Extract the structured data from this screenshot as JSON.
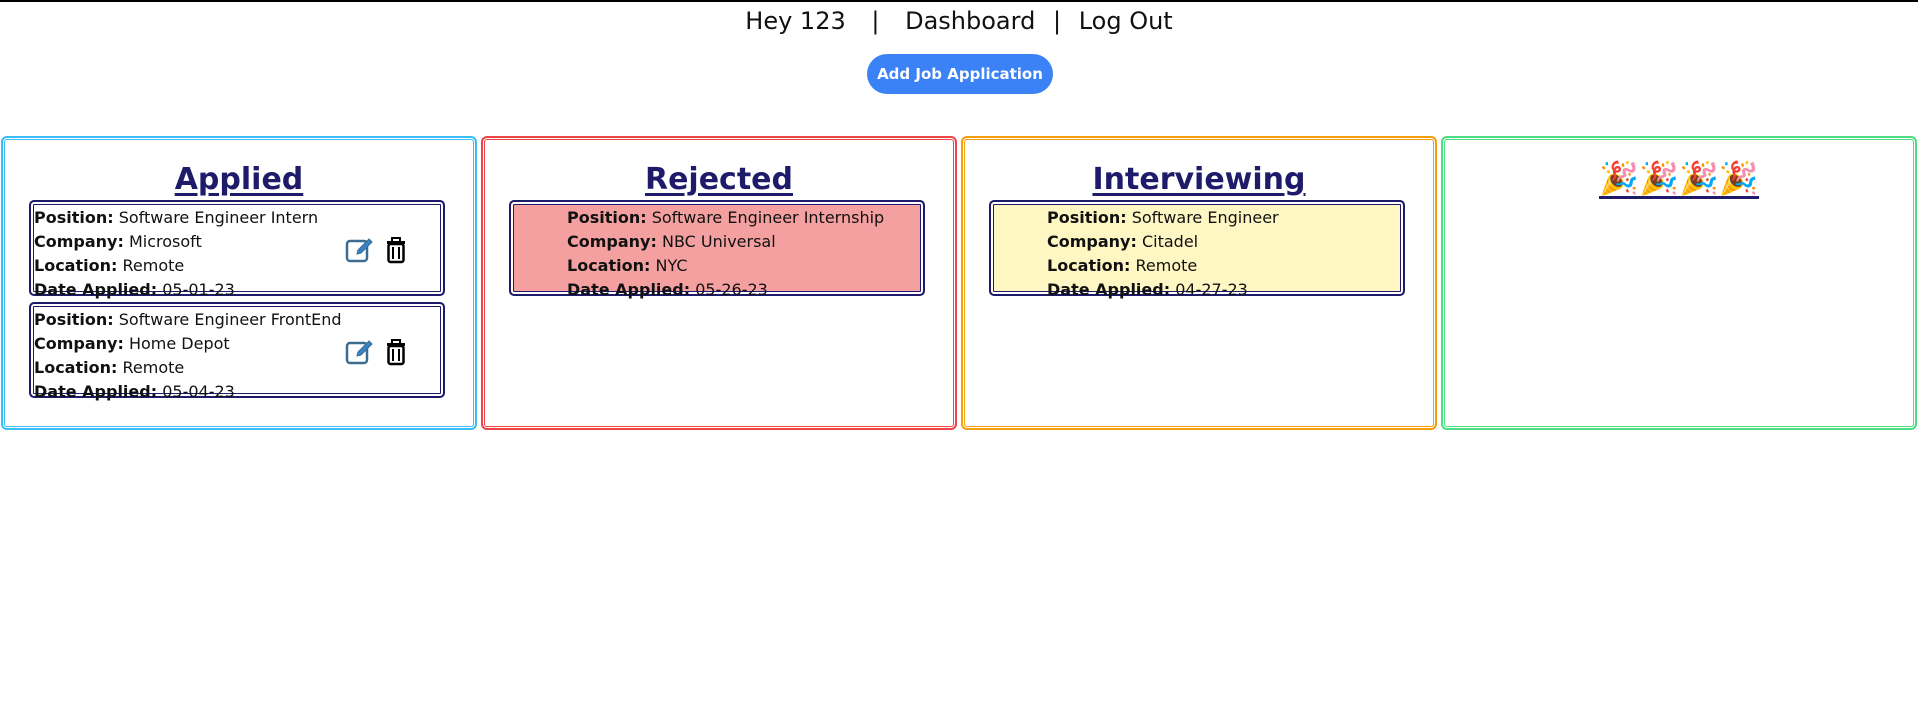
{
  "nav": {
    "greeting": "Hey 123",
    "sep1": "|",
    "dashboard": "Dashboard",
    "sep2": "|",
    "logout": "Log Out"
  },
  "add_button_label": "Add Job Application",
  "columns": {
    "applied": {
      "title": "Applied",
      "border_color": "#38bdf8",
      "cards": [
        {
          "position_label": "Position:",
          "position": "Software Engineer Intern",
          "company_label": "Company:",
          "company": "Microsoft",
          "location_label": "Location:",
          "location": "Remote",
          "date_label": "Date Applied:",
          "date": "05-01-23"
        },
        {
          "position_label": "Position:",
          "position": "Software Engineer FrontEnd",
          "company_label": "Company:",
          "company": "Home Depot",
          "location_label": "Location:",
          "location": "Remote",
          "date_label": "Date Applied:",
          "date": "05-04-23"
        }
      ]
    },
    "rejected": {
      "title": "Rejected",
      "border_color": "#ef4444",
      "card_color": "#f5a0a0",
      "cards": [
        {
          "position_label": "Position:",
          "position": "Software Engineer Internship",
          "company_label": "Company:",
          "company": "NBC Universal",
          "location_label": "Location:",
          "location": "NYC",
          "date_label": "Date Applied:",
          "date": "05-26-23"
        }
      ]
    },
    "interviewing": {
      "title": "Interviewing",
      "border_color": "#f59e0b",
      "card_color": "#fef6c3",
      "cards": [
        {
          "position_label": "Position:",
          "position": "Software Engineer",
          "company_label": "Company:",
          "company": "Citadel",
          "location_label": "Location:",
          "location": "Remote",
          "date_label": "Date Applied:",
          "date": "04-27-23"
        }
      ]
    },
    "offer": {
      "title": "🎉🎉🎉🎉",
      "border_color": "#4ade80"
    }
  },
  "icons": {
    "edit": "edit-icon",
    "delete": "trash-icon",
    "celebrate": "party-popper-icon"
  },
  "colors": {
    "accent": "#3b82f6",
    "heading": "#1e1b6b"
  }
}
